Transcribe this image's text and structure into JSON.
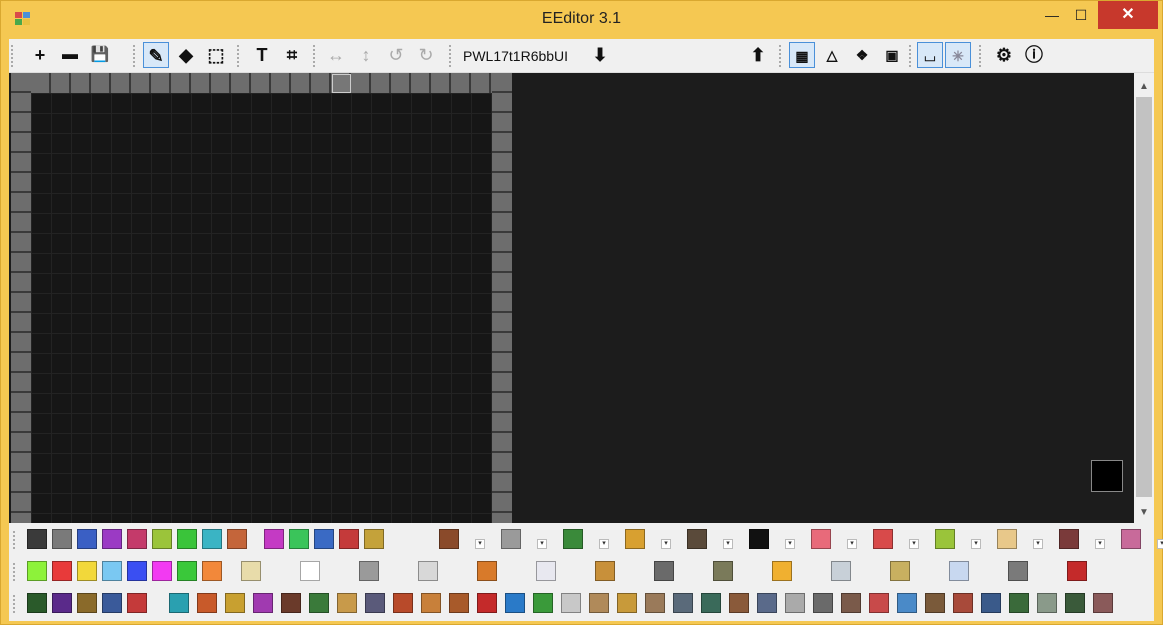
{
  "window": {
    "title": "EEditor 3.1",
    "minimize": "—",
    "maximize": "☐",
    "close": "✕"
  },
  "toolbar": {
    "new": "+",
    "open": "▬",
    "save": "💾",
    "pencil": "✎",
    "fill": "◆",
    "select": "⬚",
    "text": "T",
    "crop": "⌗",
    "flip_h": "↔",
    "flip_v": "↕",
    "rotate_left": "↺",
    "rotate_right": "↻",
    "world_id": "PWL17t1R6bbUI",
    "download": "⬇",
    "upload": "⬆",
    "settings": "⚙",
    "info": "ⓘ"
  },
  "colors": {
    "accent": "#4a90d9",
    "title_bg": "#f5c852",
    "canvas_bg": "#1c1c1c",
    "close_bg": "#c7382c"
  },
  "palette_row1": [
    "#3a3a3a",
    "#7a7a7a",
    "#3a5fc4",
    "#9b3ac4",
    "#c43a6a",
    "#9bc43a",
    "#3ac43a",
    "#3ab4c4",
    "#c4653a",
    "#c43ac4",
    "#3ac45a",
    "#3a6ac4",
    "#c43a3a",
    "#c4a23a"
  ],
  "palette_row2": [
    "#8df23a",
    "#e83a3a",
    "#f2d83a",
    "#7ac8f2",
    "#3a4ff2",
    "#f23af2",
    "#3ac83a",
    "#f2883a"
  ],
  "palette_row3": [
    "#2a5a2a",
    "#5a2a8a",
    "#8a6a2a",
    "#3a5a9a",
    "#c43a3a"
  ]
}
